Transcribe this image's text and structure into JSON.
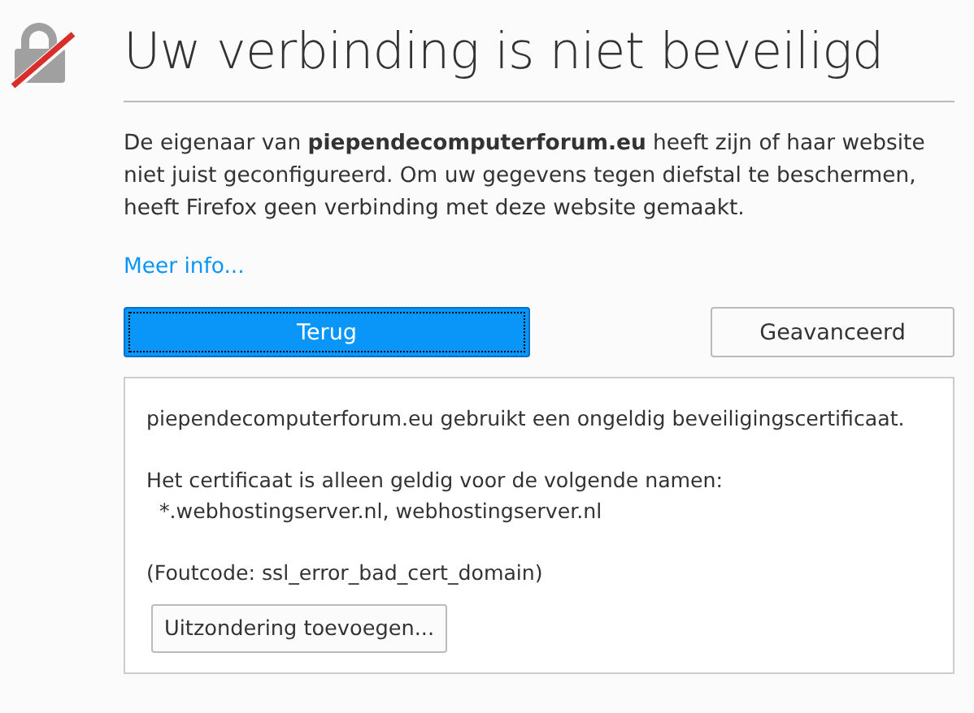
{
  "title": "Uw verbinding is niet beveiligd",
  "description": "De eigenaar van **piependecomputerforum.eu** heeft zijn of haar website niet juist geconfigureerd. Om uw gegevens tegen diefstal te beschermen, heeft Firefox geen verbinding met deze website gemaakt.",
  "more_info_link": "Meer info...",
  "buttons": [
    {
      "label": "Terug",
      "kind": "primary",
      "focused": true
    },
    {
      "label": "Geavanceerd",
      "kind": "secondary",
      "focused": false
    }
  ],
  "advanced_panel": {
    "message": "piependecomputerforum.eu gebruikt een ongeldig beveiligingscertificaat.",
    "names_intro": "Het certificaat is alleen geldig voor de volgende namen:",
    "names": "*.webhostingserver.nl, webhostingserver.nl",
    "error_code": "(Foutcode: ssl_error_bad_cert_domain)",
    "button": "Uitzondering toevoegen..."
  }
}
